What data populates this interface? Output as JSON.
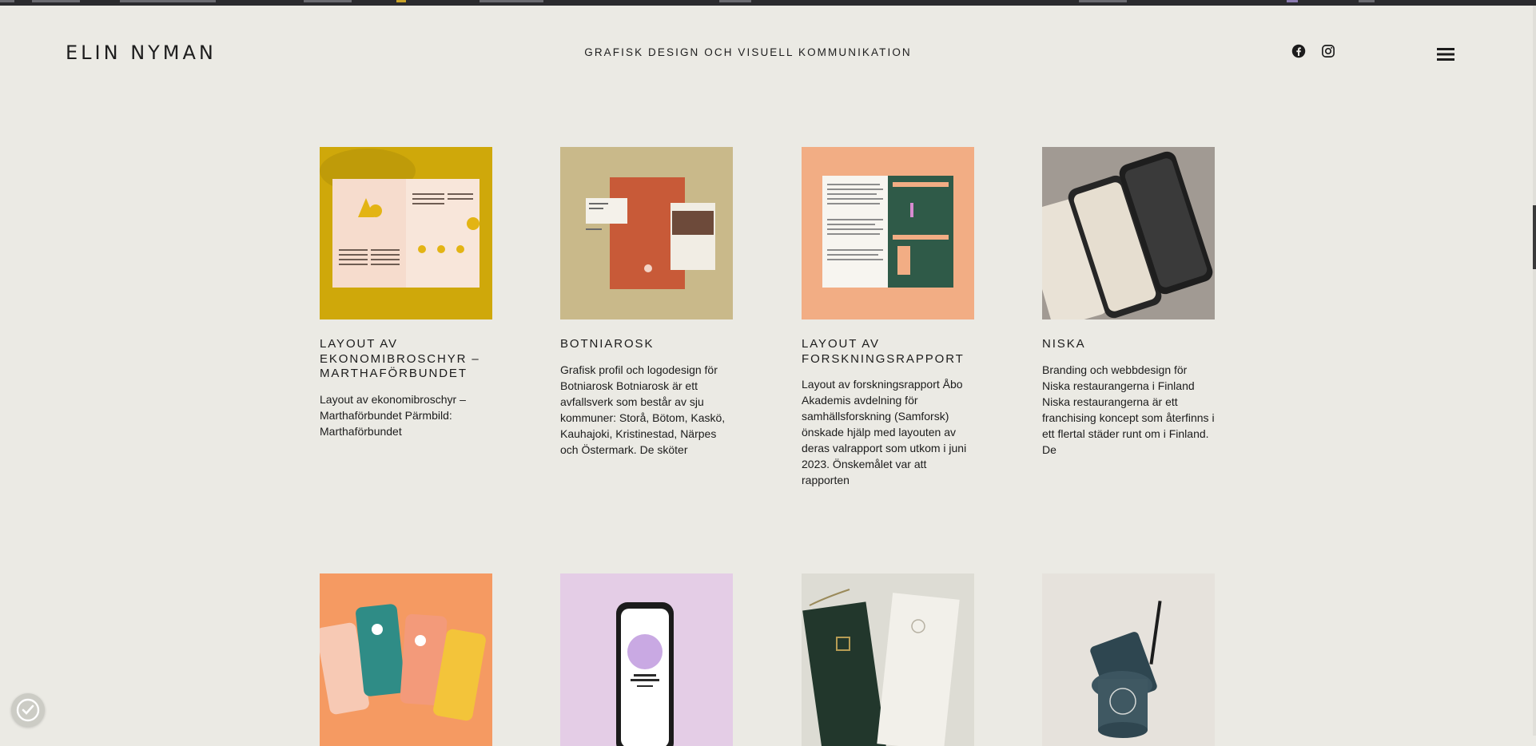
{
  "header": {
    "logo": "ELIN NYMAN",
    "tagline": "GRAFISK DESIGN OCH VISUELL KOMMUNIKATION",
    "social": [
      "facebook-icon",
      "instagram-icon"
    ],
    "menu_icon": "hamburger-menu-icon"
  },
  "projects": [
    {
      "title": "LAYOUT AV EKONOMIBROSCHYR – MARTHAFÖRBUNDET",
      "description": "Layout av ekonomibroschyr – Marthaförbundet Pärmbild: Marthaförbundet",
      "thumb_bg": "#cfa80a"
    },
    {
      "title": "BOTNIAROSK",
      "description": "Grafisk profil och logodesign för Botniarosk Botniarosk är ett avfallsverk som består av sju kommuner: Storå, Bötom, Kaskö, Kauhajoki, Kristinestad, Närpes och Östermark. De sköter",
      "thumb_bg": "#c9b98a"
    },
    {
      "title": "LAYOUT AV FORSKNINGSRAPPORT",
      "description": "Layout av forskningsrapport Åbo Akademis avdelning för samhällsforskning (Samforsk) önskade hjälp med layouten av deras valrapport som utkom i juni 2023. Önskemålet var att rapporten",
      "thumb_bg": "#f2ad84"
    },
    {
      "title": "NISKA",
      "description": "Branding och webbdesign för Niska restaurangerna i Finland Niska restaurangerna är ett franchising koncept som återfinns i ett flertal städer runt om i Finland. De",
      "thumb_bg": "#a19a93"
    },
    {
      "title": "",
      "description": "",
      "thumb_bg": "#f59a62"
    },
    {
      "title": "",
      "description": "",
      "thumb_bg": "#e4cde6"
    },
    {
      "title": "",
      "description": "",
      "thumb_bg": "#dddcd4"
    },
    {
      "title": "",
      "description": "",
      "thumb_bg": "#e6e2dc"
    }
  ],
  "widgets": {
    "cookie_icon": "cookie-consent-icon"
  }
}
